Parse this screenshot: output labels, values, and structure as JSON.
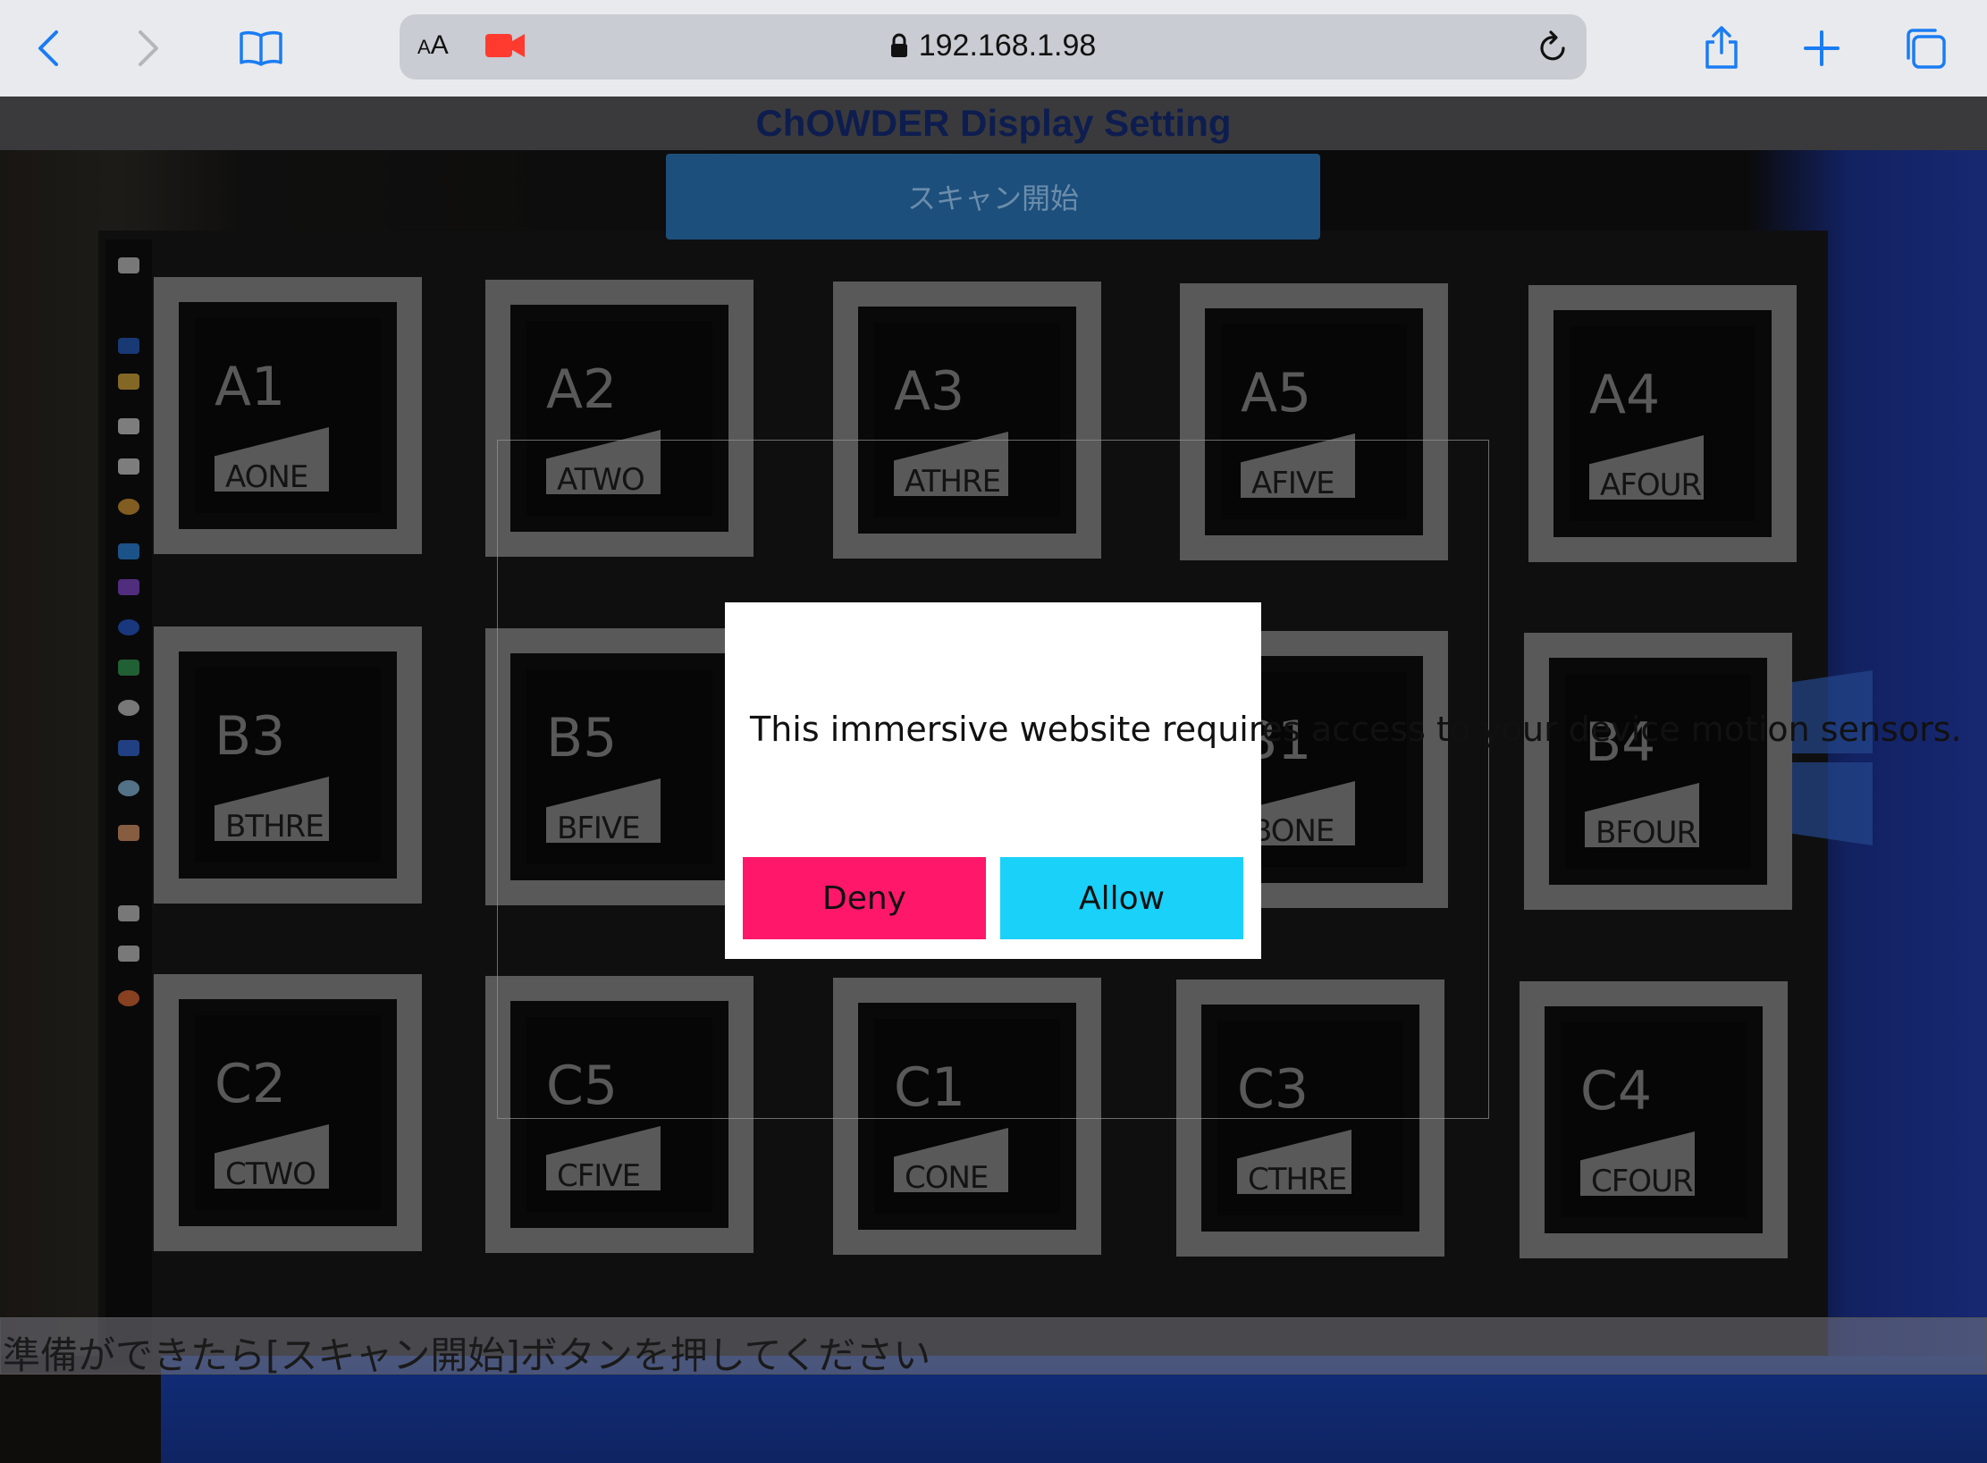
{
  "browser": {
    "text_size_label_small": "A",
    "text_size_label_large": "A",
    "url": "192.168.1.98",
    "tint": "#1a7cf3",
    "recording_color": "#ff3b30"
  },
  "page": {
    "title": "ChOWDER Display Setting",
    "scan_button_label": "スキャン開始",
    "status_message": "準備ができたら[スキャン開始]ボタンを押してください"
  },
  "markers": [
    {
      "code": "A1",
      "word": "AONE"
    },
    {
      "code": "A2",
      "word": "ATWO"
    },
    {
      "code": "A3",
      "word": "ATHRE"
    },
    {
      "code": "A5",
      "word": "AFIVE"
    },
    {
      "code": "A4",
      "word": "AFOUR"
    },
    {
      "code": "B3",
      "word": "BTHRE"
    },
    {
      "code": "B5",
      "word": "BFIVE"
    },
    {
      "code": "",
      "word": ""
    },
    {
      "code": "B1",
      "word": "BONE"
    },
    {
      "code": "B4",
      "word": "BFOUR"
    },
    {
      "code": "C2",
      "word": "CTWO"
    },
    {
      "code": "C5",
      "word": "CFIVE"
    },
    {
      "code": "C1",
      "word": "CONE"
    },
    {
      "code": "C3",
      "word": "CTHRE"
    },
    {
      "code": "C4",
      "word": "CFOUR"
    }
  ],
  "dialog": {
    "message": "This immersive website requires access to your device motion sensors.",
    "deny_label": "Deny",
    "allow_label": "Allow",
    "deny_color": "#ff1769",
    "allow_color": "#1ad1f9"
  }
}
